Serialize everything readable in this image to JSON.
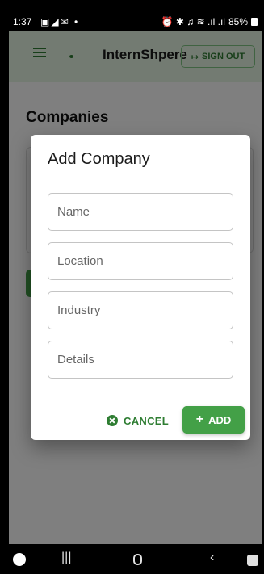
{
  "status_bar": {
    "time": "1:37",
    "left_icons": "▣◢✉ •",
    "right_icons": "⏰ ✱ ♫ ≋ .ıl .ıl",
    "battery": "85%"
  },
  "app_bar": {
    "title": "InternShpere",
    "sign_out_label": "SIGN OUT"
  },
  "page": {
    "heading": "Companies"
  },
  "dialog": {
    "title": "Add Company",
    "fields": [
      {
        "placeholder": "Name",
        "value": ""
      },
      {
        "placeholder": "Location",
        "value": ""
      },
      {
        "placeholder": "Industry",
        "value": ""
      },
      {
        "placeholder": "Details",
        "value": ""
      }
    ],
    "cancel_label": "CANCEL",
    "add_label": "ADD"
  },
  "nav_bar": {
    "recents_glyph": "|||",
    "back_glyph": "‹"
  },
  "colors": {
    "accent": "#43a047",
    "accent_text": "#2e7d32",
    "appbar_bg": "#e7f6e4"
  }
}
